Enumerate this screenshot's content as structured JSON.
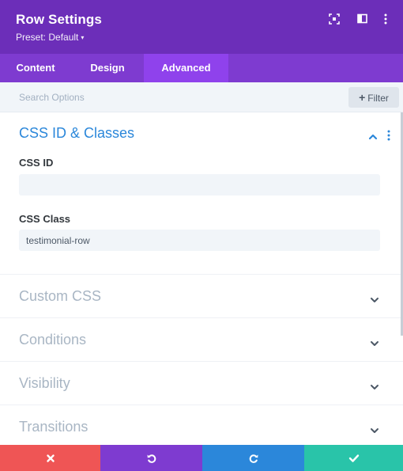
{
  "header": {
    "title": "Row Settings",
    "preset": "Preset: Default",
    "icons": [
      "focus-icon",
      "sidebar-layout-icon",
      "more-vertical-icon"
    ],
    "color": "#6c2eb9"
  },
  "tabs": [
    {
      "label": "Content",
      "active": false
    },
    {
      "label": "Design",
      "active": false
    },
    {
      "label": "Advanced",
      "active": true
    }
  ],
  "search": {
    "placeholder": "Search Options",
    "value": "",
    "filter_label": "Filter"
  },
  "sections": {
    "css": {
      "title": "CSS ID & Classes",
      "expanded": true,
      "css_id_label": "CSS ID",
      "css_id_value": "",
      "css_class_label": "CSS Class",
      "css_class_value": "testimonial-row"
    },
    "custom_css": {
      "title": "Custom CSS",
      "expanded": false
    },
    "conditions": {
      "title": "Conditions",
      "expanded": false
    },
    "visibility": {
      "title": "Visibility",
      "expanded": false
    },
    "transitions": {
      "title": "Transitions",
      "expanded": false
    }
  },
  "footer": {
    "buttons": [
      {
        "name": "cancel",
        "icon": "close-icon",
        "color": "#ef5555"
      },
      {
        "name": "undo",
        "icon": "undo-icon",
        "color": "#7e3bd0"
      },
      {
        "name": "redo",
        "icon": "redo-icon",
        "color": "#2b87da"
      },
      {
        "name": "save",
        "icon": "check-icon",
        "color": "#29c4a9"
      }
    ]
  },
  "colors": {
    "accent_purple": "#8f42ec",
    "section_blue": "#2b87da",
    "muted_text": "#a9b6c4"
  }
}
